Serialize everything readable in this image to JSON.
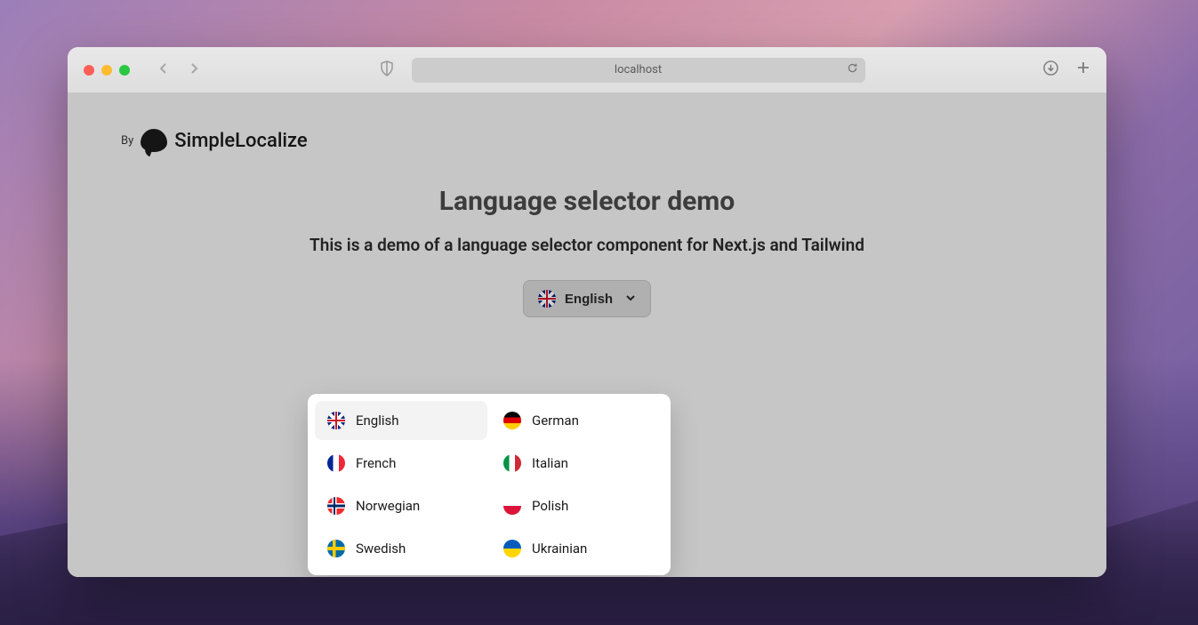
{
  "browser": {
    "url": "localhost"
  },
  "brand": {
    "prefix": "By",
    "name": "SimpleLocalize"
  },
  "page": {
    "title": "Language selector demo",
    "subtitle": "This is a demo of a language selector component for Next.js and Tailwind"
  },
  "selector": {
    "current_label": "English",
    "current_flag": "gb"
  },
  "languages": [
    {
      "label": "English",
      "flag": "gb",
      "active": true
    },
    {
      "label": "German",
      "flag": "de",
      "active": false
    },
    {
      "label": "French",
      "flag": "fr",
      "active": false
    },
    {
      "label": "Italian",
      "flag": "it",
      "active": false
    },
    {
      "label": "Norwegian",
      "flag": "no",
      "active": false
    },
    {
      "label": "Polish",
      "flag": "pl",
      "active": false
    },
    {
      "label": "Swedish",
      "flag": "se",
      "active": false
    },
    {
      "label": "Ukrainian",
      "flag": "ua",
      "active": false
    }
  ]
}
